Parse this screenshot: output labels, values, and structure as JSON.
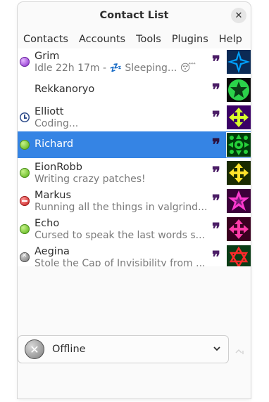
{
  "window": {
    "title": "Contact List",
    "close_icon": "close-icon"
  },
  "menu": [
    "Contacts",
    "Accounts",
    "Tools",
    "Plugins",
    "Help"
  ],
  "contacts": [
    {
      "name": "Grim",
      "message": "Idle 22h 17m - 💤 Sleeping... 😴",
      "status": "away",
      "avatar": "blue-star-icon",
      "colors": [
        "#00a2ff",
        "#0b2a55"
      ]
    },
    {
      "name": "Rekkanoryo",
      "message": "",
      "status": "none",
      "avatar": "green-star-icon",
      "colors": [
        "#2bd24a",
        "#0a3d16"
      ]
    },
    {
      "name": "Elliott",
      "message": "Coding...",
      "status": "idle",
      "avatar": "yellow-arrows-icon",
      "colors": [
        "#d8ff2a",
        "#6b00c9"
      ]
    },
    {
      "name": "Richard",
      "message": "",
      "status": "available",
      "avatar": "green-pattern-icon",
      "colors": [
        "#26d23a",
        "#003d0a"
      ]
    },
    {
      "name": "EionRobb",
      "message": "Writing crazy patches!",
      "status": "available",
      "avatar": "yellow-arrows-icon",
      "colors": [
        "#ffe22a",
        "#1a2b00"
      ]
    },
    {
      "name": "Markus",
      "message": "Running all the things in valgrind...",
      "status": "busy",
      "avatar": "pink-star-icon",
      "colors": [
        "#ff3ad0",
        "#3c003a"
      ]
    },
    {
      "name": "Echo",
      "message": "Cursed to speak the last words s...",
      "status": "available",
      "avatar": "pink-arrows-icon",
      "colors": [
        "#ff3aa8",
        "#3a0020"
      ]
    },
    {
      "name": "Aegina",
      "message": "Stole the Cap of Invisibility from ...",
      "status": "offline",
      "avatar": "star-of-david-icon",
      "colors": [
        "#ff2a2a",
        "#0a3d16"
      ]
    }
  ],
  "selected_contact": "Richard",
  "status_selector": {
    "label": "Offline",
    "icon": "offline-icon"
  }
}
